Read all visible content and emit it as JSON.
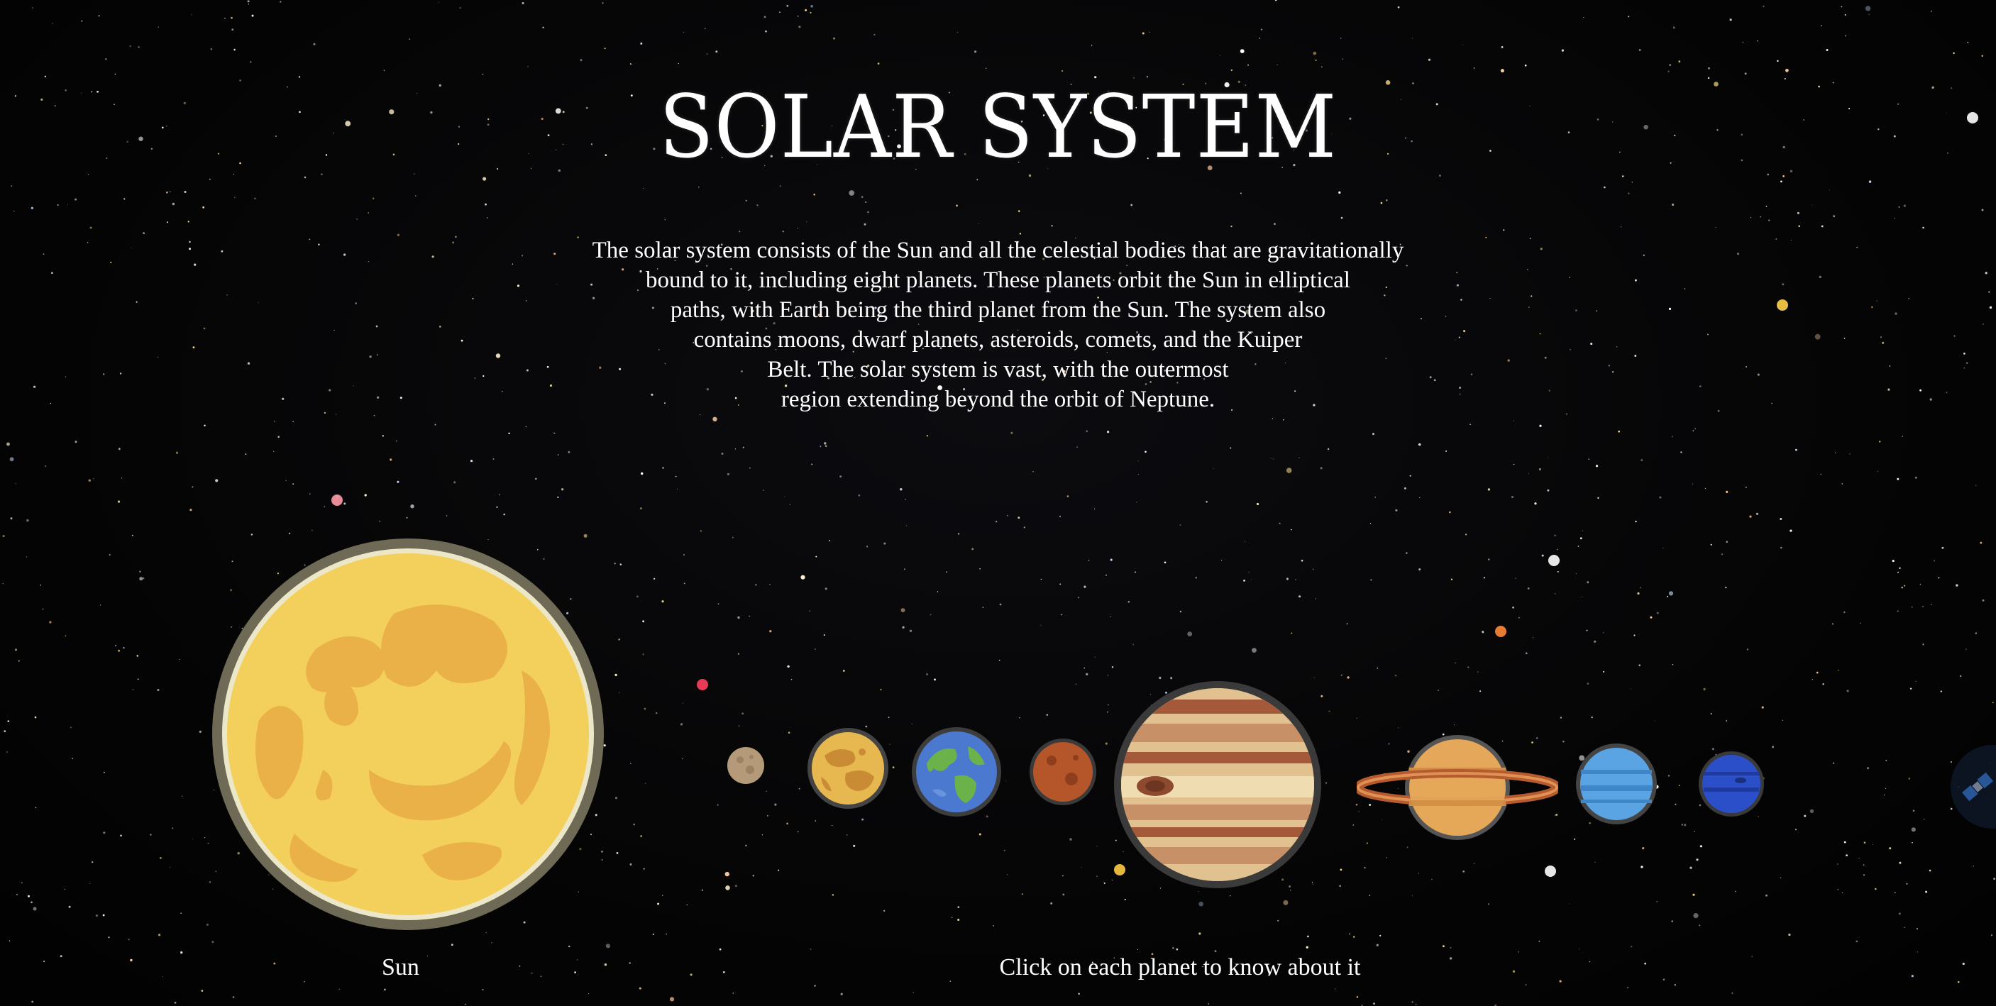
{
  "page": {
    "title": "SOLAR SYSTEM",
    "description_lines": [
      "The solar system consists of the Sun and all the celestial bodies that are gravitationally",
      "bound to it, including eight planets. These planets orbit the Sun in elliptical",
      "paths, with Earth being the third planet from the Sun. The system also",
      "contains moons, dwarf planets, asteroids, comets, and the Kuiper",
      "Belt. The solar system is vast, with the outermost",
      "region extending beyond the orbit of Neptune."
    ],
    "sun_label": "Sun",
    "hint": "Click on each planet to know about it"
  },
  "bodies": [
    {
      "id": "sun",
      "icon": "sun-icon"
    },
    {
      "id": "mercury",
      "icon": "mercury-icon"
    },
    {
      "id": "venus",
      "icon": "venus-icon"
    },
    {
      "id": "earth",
      "icon": "earth-icon"
    },
    {
      "id": "mars",
      "icon": "mars-icon"
    },
    {
      "id": "jupiter",
      "icon": "jupiter-icon"
    },
    {
      "id": "saturn",
      "icon": "saturn-icon"
    },
    {
      "id": "uranus",
      "icon": "uranus-icon"
    },
    {
      "id": "neptune",
      "icon": "neptune-icon"
    }
  ],
  "colors": {
    "background": "#050505",
    "text": "#ffffff",
    "sun": "#f3cf5c",
    "sun_rim": "#6e6a55"
  }
}
